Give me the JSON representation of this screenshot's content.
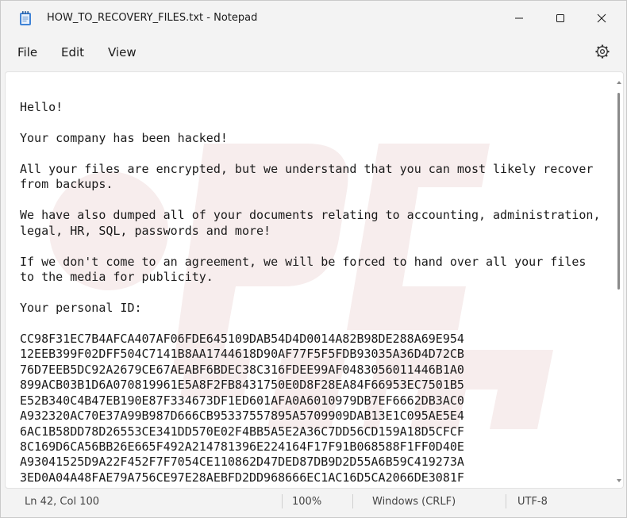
{
  "window": {
    "title": "HOW_TO_RECOVERY_FILES.txt - Notepad",
    "app_icon": "notepad-icon",
    "controls": {
      "minimize_icon": "minimize-icon",
      "maximize_icon": "maximize-icon",
      "close_icon": "close-icon"
    }
  },
  "menu": {
    "file": "File",
    "edit": "Edit",
    "view": "View",
    "settings_icon": "gear-icon"
  },
  "editor": {
    "content": "Hello!\n\nYour company has been hacked!\n\nAll your files are encrypted, but we understand that you can most likely recover\nfrom backups.\n\nWe have also dumped all of your documents relating to accounting, administration,\nlegal, HR, SQL, passwords and more!\n\nIf we don't come to an agreement, we will be forced to hand over all your files\nto the media for publicity.\n\nYour personal ID:\n\nCC98F31EC7B4AFCA407AF06FDE645109DAB54D4D0014A82B98DE288A69E954\n12EEB399F02DFF504C7141B8AA1744618D90AF77F5F5FDB93035A36D4D72CB\n76D7EEB5DC92A2679CE67AEABF6BDEC38C316FDEE99AF0483056011446B1A0\n899ACB03B1D6A070819961E5A8F2FB8431750E0D8F28EA84F66953EC7501B5\nE52B340C4B47EB190E87F334673DF1ED601AFA0A6010979DB7EF6662DB3AC0\nA932320AC70E37A99B987D666CB95337557895A5709909DAB13E1C095AE5E4\n6AC1B58DD78D26553CE341DD570E02F4BB5A5E2A36C7DD56CD159A18D5CFCF\n8C169D6CA56BB26E665F492A214781396E224164F17F91B068588F1FF0D40E\nA93041525D9A22F452F7F7054CE110862D47DED87DB9D2D55A6B59C419273A\n3ED0A04A48FAE79A756CE97E28AEBFD2DD968666EC1AC16D5CA2066DE3081F",
    "watermark_color": "#f7eded",
    "watermark_accent": "#fbe9dc"
  },
  "status": {
    "position": "Ln 42, Col 100",
    "zoom": "100%",
    "line_ending": "Windows (CRLF)",
    "encoding": "UTF-8"
  }
}
